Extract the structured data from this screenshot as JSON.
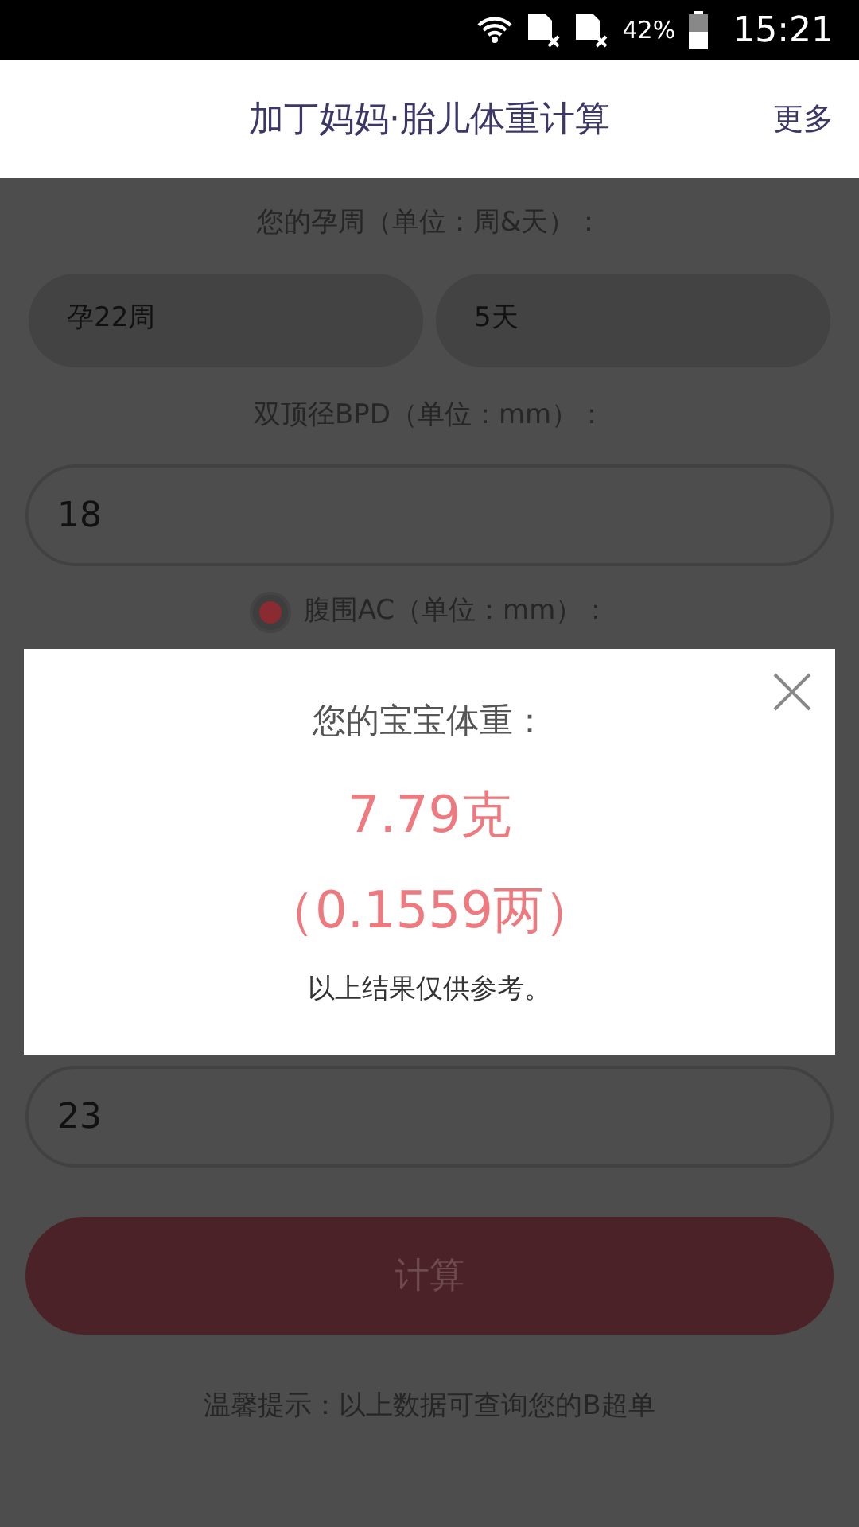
{
  "status_bar": {
    "battery": "42%",
    "time": "15:21"
  },
  "header": {
    "title": "加丁妈妈·胎儿体重计算",
    "more": "更多"
  },
  "form": {
    "week_label": "您的孕周（单位：周&天）：",
    "week": "孕22周",
    "day": "5天",
    "bpd_label": "双顶径BPD（单位：mm）：",
    "bpd": "18",
    "ac_option": {
      "label": "腹围AC（单位：mm）：",
      "selected": true
    },
    "field_4": "23",
    "submit": "计算",
    "tip": "温馨提示：以上数据可查询您的B超单"
  },
  "dialog": {
    "title": "您的宝宝体重：",
    "weight": "7.79克",
    "weight_alt": "（0.1559两）",
    "note": "以上结果仅供参考。"
  }
}
